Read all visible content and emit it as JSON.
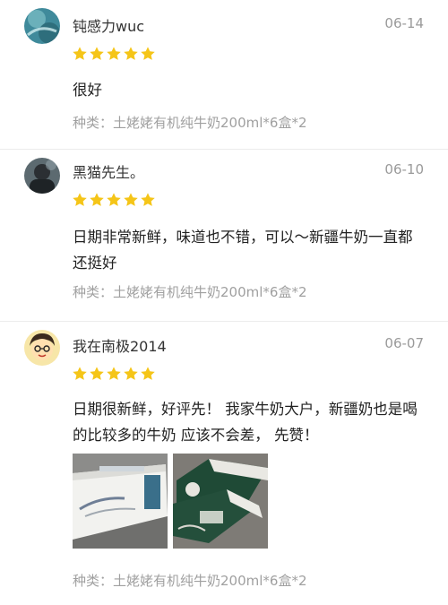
{
  "reviews": [
    {
      "username": "钝感力wuc",
      "date": "06-14",
      "rating": 5,
      "content": "很好",
      "variant": "种类：土姥姥有机纯牛奶200ml*6盒*2"
    },
    {
      "username": "黑猫先生。",
      "date": "06-10",
      "rating": 5,
      "content": "日期非常新鲜，味道也不错，可以～新疆牛奶一直都还挺好",
      "variant": "种类：土姥姥有机纯牛奶200ml*6盒*2"
    },
    {
      "username": "我在南极2014",
      "date": "06-07",
      "rating": 5,
      "content": "日期很新鲜，好评先！ 我家牛奶大户，新疆奶也是喝的比较多的牛奶 应该不会差， 先赞！",
      "variant": "种类：土姥姥有机纯牛奶200ml*6盒*2",
      "photos": [
        "milk-box-photo",
        "milk-box-green-photo"
      ]
    }
  ],
  "colors": {
    "star": "#f5c518",
    "date": "#9a9a9a",
    "variant": "#a0a0a0",
    "divider": "#ececec"
  },
  "icons": [
    "avatar-image",
    "star-icon"
  ]
}
